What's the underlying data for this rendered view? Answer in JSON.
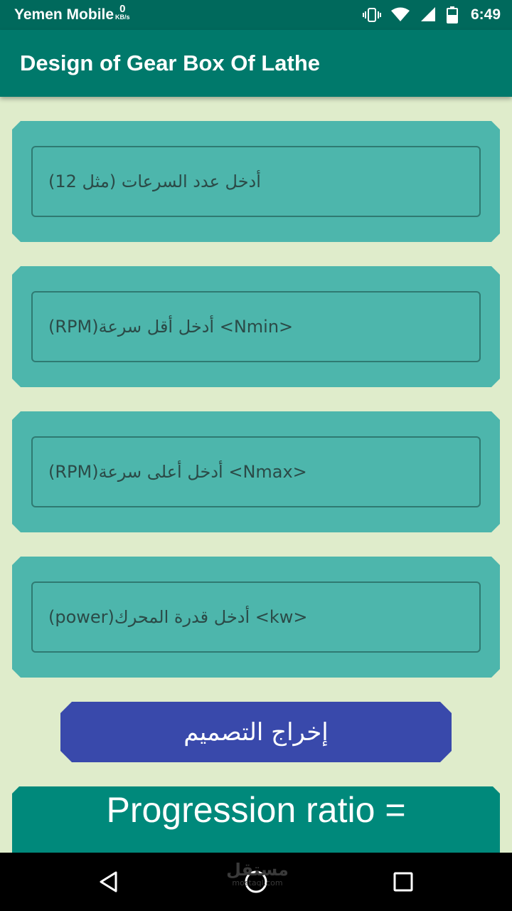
{
  "status_bar": {
    "carrier": "Yemen Mobile",
    "net_speed_value": "0",
    "net_speed_unit": "KB/s",
    "time": "6:49",
    "icons": [
      "vibrate-icon",
      "wifi-icon",
      "signal-icon",
      "battery-icon"
    ]
  },
  "app_bar": {
    "title": "Design of Gear Box Of Lathe"
  },
  "inputs": [
    {
      "placeholder": "أدخل عدد السرعات (مثل 12)"
    },
    {
      "placeholder": "(RPM)أدخل أقل سرعة <Nmin>"
    },
    {
      "placeholder": "(RPM)أدخل أعلى سرعة <Nmax>"
    },
    {
      "placeholder": "(power)أدخل قدرة المحرك <kw>"
    }
  ],
  "action_button": {
    "label": "إخراج التصميم"
  },
  "result": {
    "label": "Progression ratio ="
  },
  "watermark": {
    "arabic": "مستقل",
    "latin": "mostaql.com"
  },
  "nav_bar": {
    "icons": [
      "back-icon",
      "home-icon",
      "recents-icon"
    ]
  },
  "colors": {
    "status_bar": "#00695c",
    "app_bar": "#00796b",
    "background": "#dfeccb",
    "card": "#4db6ac",
    "button": "#3949ab",
    "result_card": "#00897b"
  }
}
